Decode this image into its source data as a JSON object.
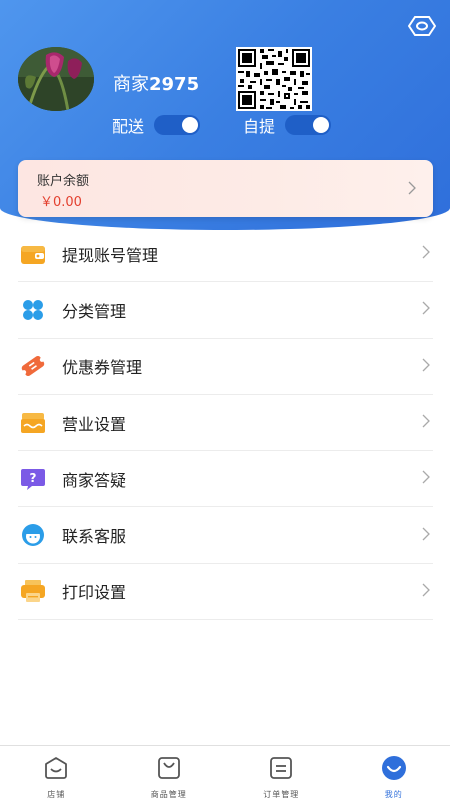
{
  "header": {
    "store_prefix": "商家",
    "store_number": "2975",
    "delivery_label": "配送",
    "delivery_enabled": true,
    "pickup_label": "自提",
    "pickup_enabled": true,
    "accent_color": "#3a7fe2"
  },
  "balance": {
    "title": "账户余额",
    "value": "￥0.00"
  },
  "menu": {
    "items": [
      {
        "label": "提现账号管理",
        "icon": "wallet-icon"
      },
      {
        "label": "分类管理",
        "icon": "category-icon"
      },
      {
        "label": "优惠券管理",
        "icon": "coupon-icon"
      },
      {
        "label": "营业设置",
        "icon": "store-settings-icon"
      },
      {
        "label": "商家答疑",
        "icon": "faq-icon"
      },
      {
        "label": "联系客服",
        "icon": "customer-service-icon"
      },
      {
        "label": "打印设置",
        "icon": "printer-icon"
      }
    ]
  },
  "bottom_nav": {
    "items": [
      {
        "label": "店铺",
        "icon": "store-icon",
        "active": false
      },
      {
        "label": "商品管理",
        "icon": "bag-icon",
        "active": false
      },
      {
        "label": "订单管理",
        "icon": "order-icon",
        "active": false
      },
      {
        "label": "我的",
        "icon": "profile-icon",
        "active": true
      }
    ]
  }
}
